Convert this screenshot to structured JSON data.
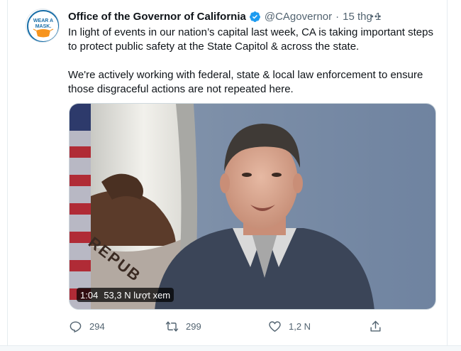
{
  "tweet": {
    "avatar": {
      "badge_line1": "WEAR A",
      "badge_line2": "MASK."
    },
    "display_name": "Office of the Governor of California",
    "handle": "@CAgovernor",
    "separator": "·",
    "date": "15 thg 1",
    "paragraphs": [
      "In light of events in our nation’s capital last week, CA is taking important steps to protect public safety at the State Capitol & across the state.",
      "We're actively working with federal, state & local law enforcement to ensure those disgraceful actions are not repeated here."
    ],
    "media": {
      "duration": "1:04",
      "views": "53,3 N lượt xem",
      "flag_text": "REPUB"
    },
    "actions": {
      "replies": "294",
      "retweets": "299",
      "likes": "1,2 N"
    }
  },
  "colors": {
    "text_primary": "#0f1419",
    "text_secondary": "#536471",
    "verified_blue": "#1d9bf0",
    "badge_orange": "#f7941d",
    "badge_blue": "#1a6fa8"
  }
}
